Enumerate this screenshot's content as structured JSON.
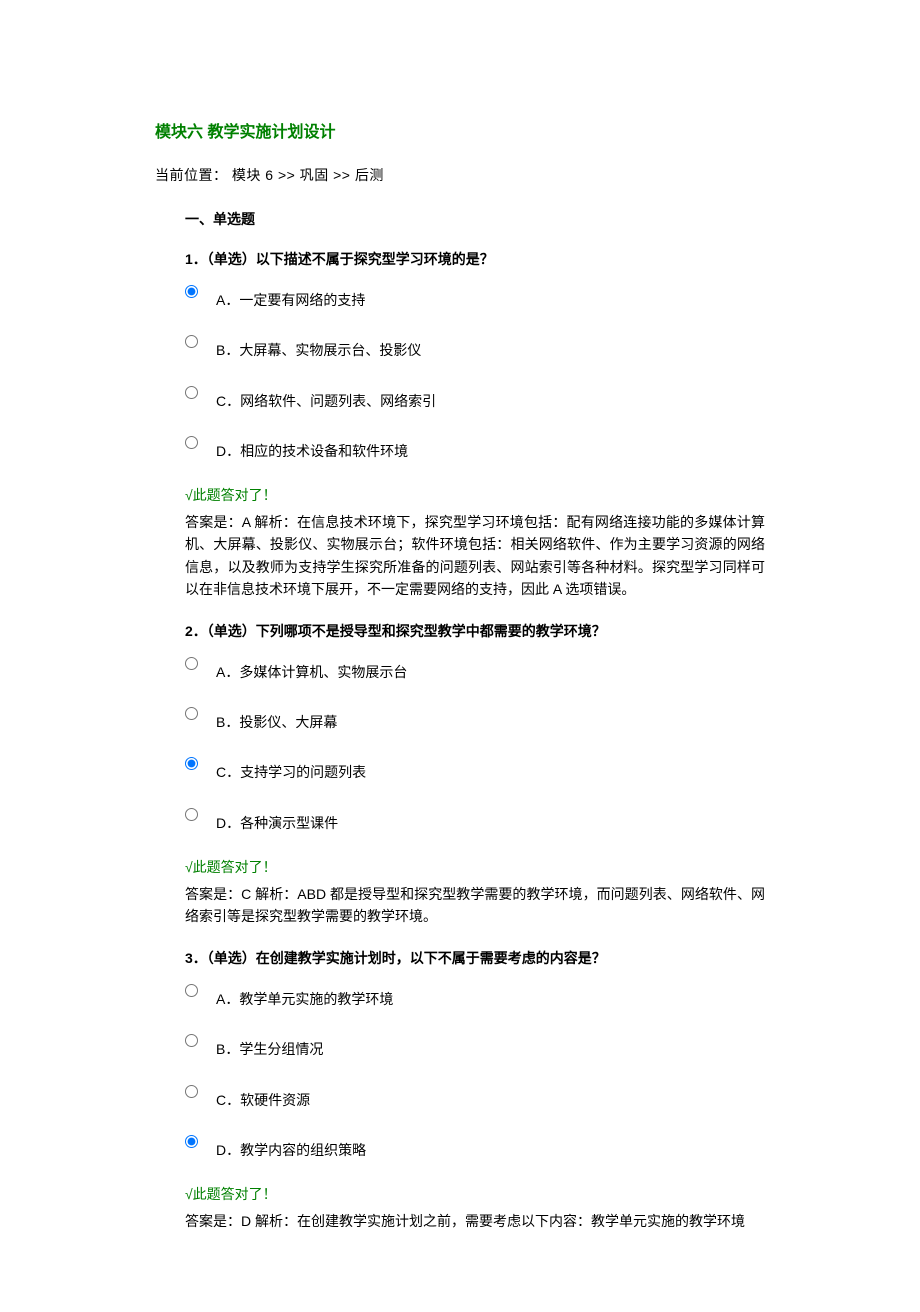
{
  "page_title": "模块六 教学实施计划设计",
  "breadcrumb": "当前位置：  模块 6 >> 巩固 >> 后测",
  "section_heading": "一、单选题",
  "questions": [
    {
      "prompt": "1．（单选）以下描述不属于探究型学习环境的是？",
      "options": [
        "A．一定要有网络的支持",
        "B．大屏幕、实物展示台、投影仪",
        "C．网络软件、问题列表、网络索引",
        "D．相应的技术设备和软件环境"
      ],
      "selected": 0,
      "correct_msg": "√此题答对了！",
      "answer": "答案是：A 解析：在信息技术环境下，探究型学习环境包括：配有网络连接功能的多媒体计算机、大屏幕、投影仪、实物展示台；软件环境包括：相关网络软件、作为主要学习资源的网络信息，以及教师为支持学生探究所准备的问题列表、网站索引等各种材料。探究型学习同样可以在非信息技术环境下展开，不一定需要网络的支持，因此 A 选项错误。"
    },
    {
      "prompt": "2．（单选）下列哪项不是授导型和探究型教学中都需要的教学环境？",
      "options": [
        "A．多媒体计算机、实物展示台",
        "B．投影仪、大屏幕",
        "C．支持学习的问题列表",
        "D．各种演示型课件"
      ],
      "selected": 2,
      "correct_msg": "√此题答对了！",
      "answer": "答案是：C 解析：ABD 都是授导型和探究型教学需要的教学环境，而问题列表、网络软件、网络索引等是探究型教学需要的教学环境。"
    },
    {
      "prompt": "3．（单选）在创建教学实施计划时，以下不属于需要考虑的内容是？",
      "options": [
        "A．教学单元实施的教学环境",
        "B．学生分组情况",
        "C．软硬件资源",
        "D．教学内容的组织策略"
      ],
      "selected": 3,
      "correct_msg": "√此题答对了！",
      "answer": "答案是：D 解析：在创建教学实施计划之前，需要考虑以下内容：教学单元实施的教学环境"
    }
  ]
}
